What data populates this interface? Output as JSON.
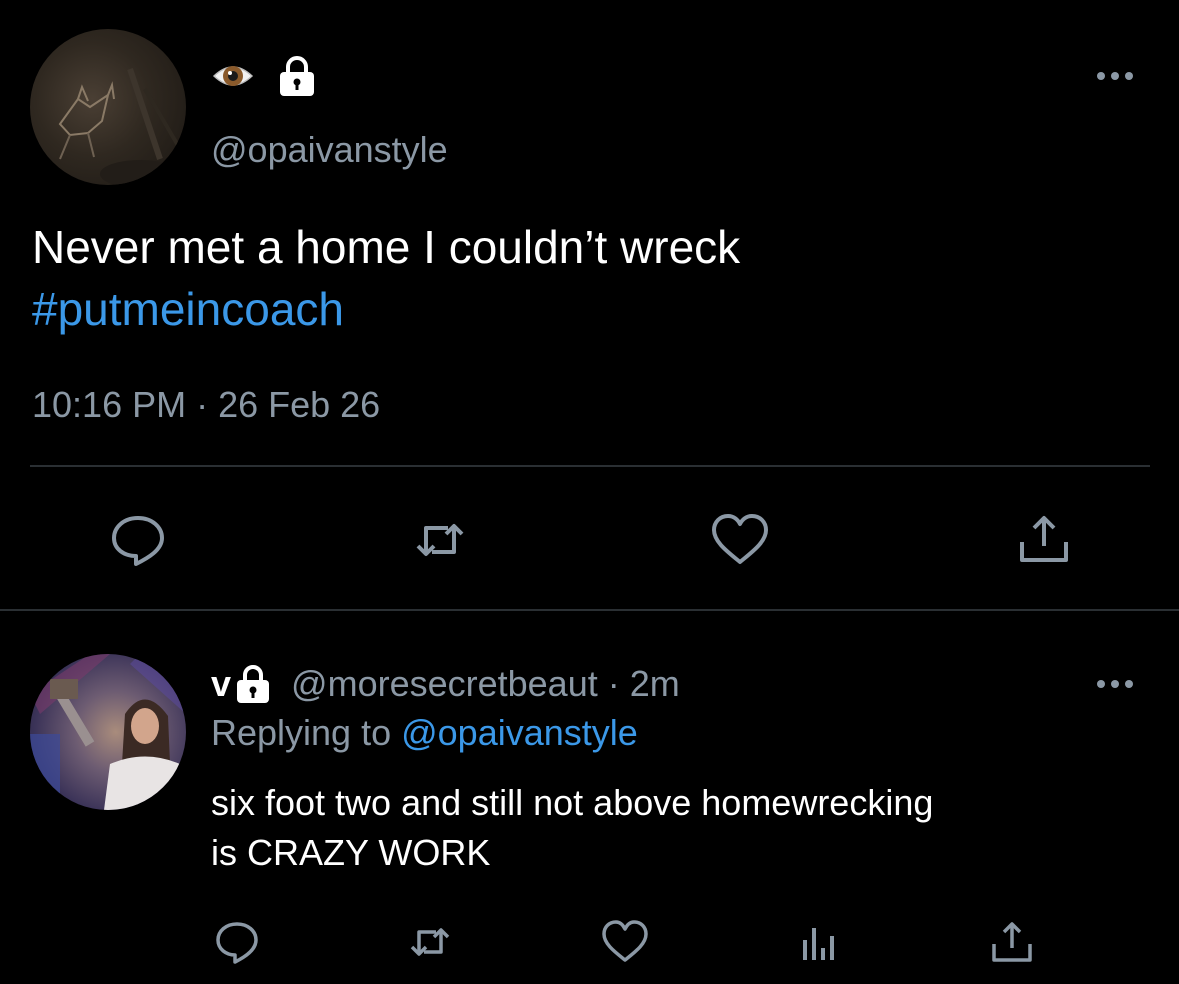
{
  "colors": {
    "background": "#000000",
    "text": "#ffffff",
    "muted": "#8b98a5",
    "accent": "#3b98e8",
    "divider": "#2a2f33"
  },
  "main_tweet": {
    "display_name_icons": [
      "eye-emoji",
      "lock-icon"
    ],
    "handle": "@opaivanstyle",
    "text_line_1": "Never met a home I couldn’t wreck",
    "hashtag": "#putmeincoach",
    "timestamp": "10:16 PM · 26 Feb 26",
    "actions": [
      "reply-icon",
      "retweet-icon",
      "like-icon",
      "share-icon"
    ]
  },
  "reply": {
    "display_name": "v",
    "handle_and_time": "@moresecretbeaut · 2m",
    "replying_to_prefix": "Replying to ",
    "replying_to_handle": "@opaivanstyle",
    "text_line_1": "six foot two and still not above homewrecking",
    "text_line_2": "is CRAZY WORK",
    "actions": [
      "reply-icon",
      "retweet-icon",
      "like-icon",
      "analytics-icon",
      "share-icon"
    ]
  }
}
